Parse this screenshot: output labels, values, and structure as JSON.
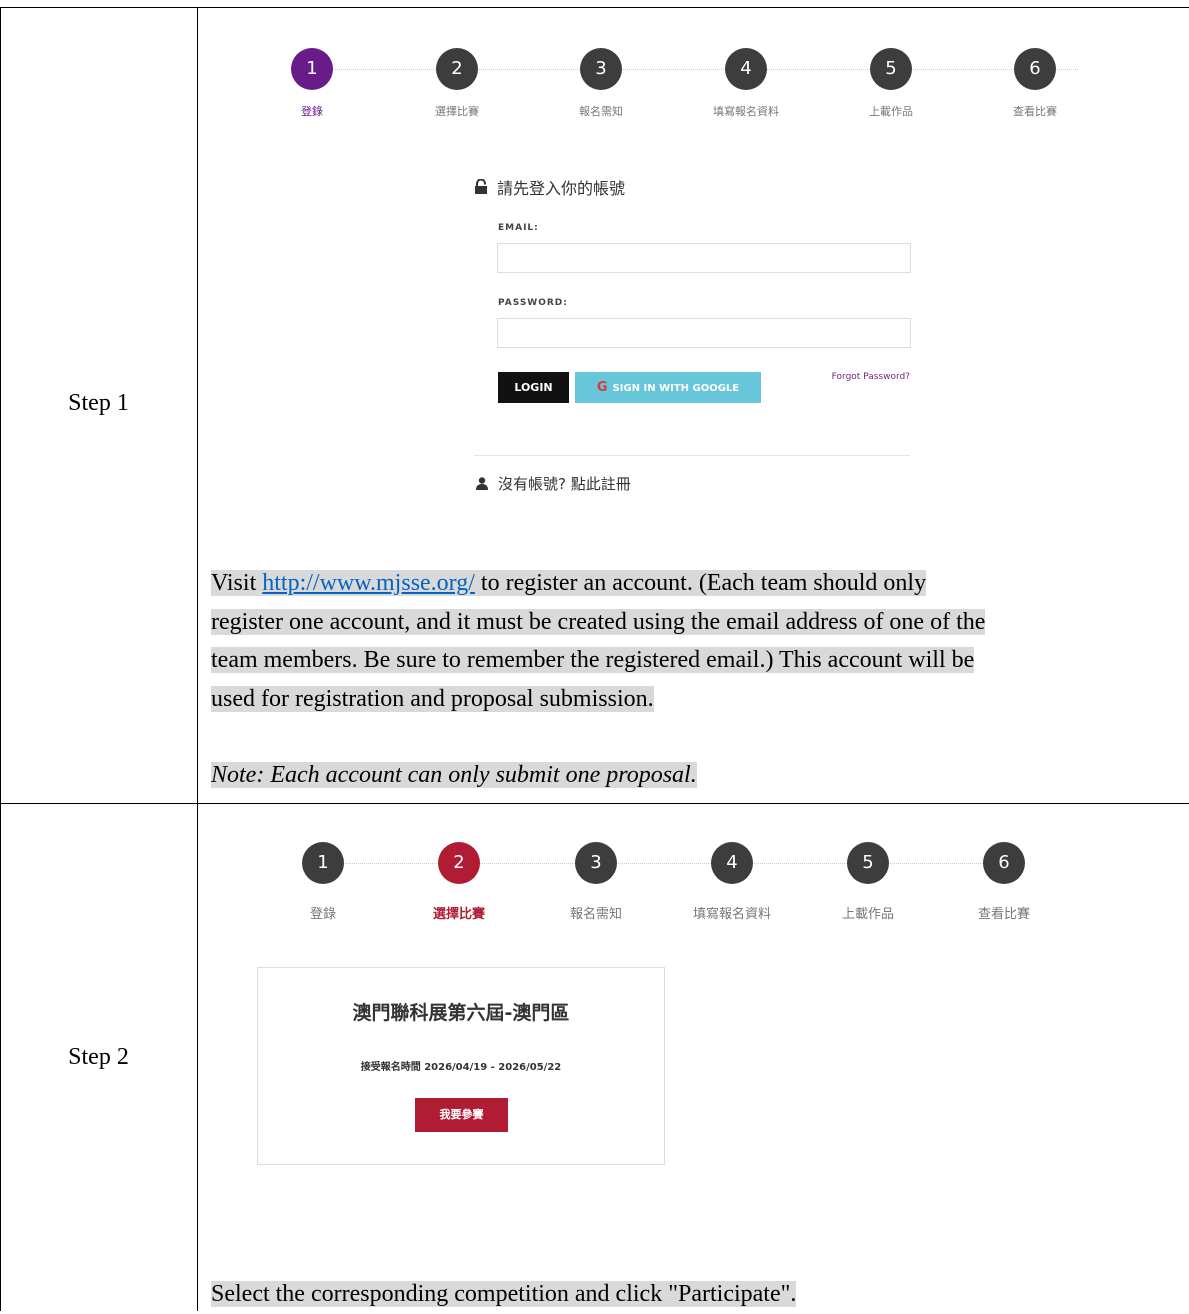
{
  "step1": {
    "label": "Step 1",
    "stepper": [
      {
        "num": "1",
        "label": "登錄"
      },
      {
        "num": "2",
        "label": "選擇比賽"
      },
      {
        "num": "3",
        "label": "報名需知"
      },
      {
        "num": "4",
        "label": "填寫報名資料"
      },
      {
        "num": "5",
        "label": "上載作品"
      },
      {
        "num": "6",
        "label": "查看比賽"
      }
    ],
    "login": {
      "heading": "請先登入你的帳號",
      "email_label": "EMAIL:",
      "password_label": "PASSWORD:",
      "login_button": "LOGIN",
      "google_button": "SIGN IN WITH GOOGLE",
      "google_g": "G",
      "forgot": "Forgot Password?",
      "register": "沒有帳號? 點此註冊"
    },
    "text_visit": "Visit ",
    "link": "http://www.mjsse.org/",
    "text_line1_rest": " to register an account. (Each team should only",
    "text_line2": "register one account, and it must be created using the email address of one of the",
    "text_line3": "team members. Be sure to remember the registered email.) This account will be",
    "text_line4": "used for registration and proposal submission.",
    "note": "Note: Each account can only submit one proposal."
  },
  "step2": {
    "label": "Step 2",
    "stepper": [
      {
        "num": "1",
        "label": "登錄"
      },
      {
        "num": "2",
        "label": "選擇比賽"
      },
      {
        "num": "3",
        "label": "報名需知"
      },
      {
        "num": "4",
        "label": "填寫報名資料"
      },
      {
        "num": "5",
        "label": "上載作品"
      },
      {
        "num": "6",
        "label": "查看比賽"
      }
    ],
    "card": {
      "title": "澳門聯科展第六屆-澳門區",
      "period": "接受報名時間 2026/04/19 - 2026/05/22",
      "button": "我要參賽"
    },
    "text": "Select the corresponding competition and click \"Participate\"."
  },
  "colors": {
    "step1_active": "#6a1b8a",
    "step2_active": "#b01c33",
    "inactive": "#3d3d3d",
    "google": "#67c6d9",
    "participate": "#b01c33"
  }
}
